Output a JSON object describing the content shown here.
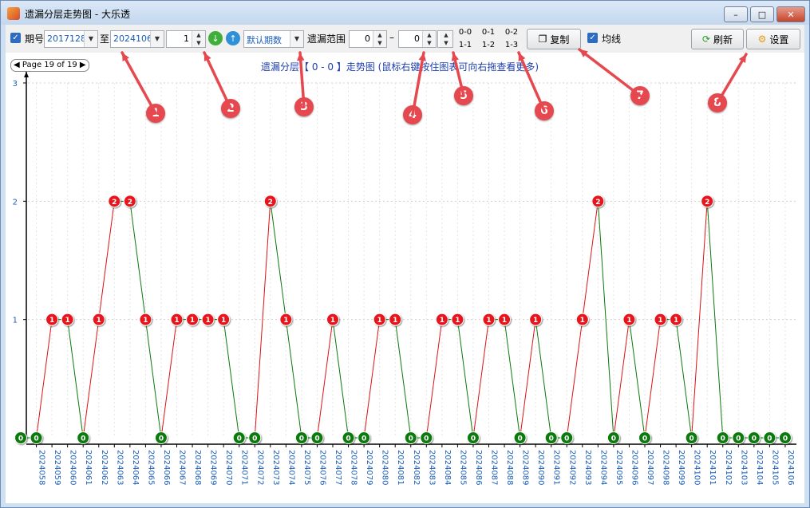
{
  "window": {
    "title": "遗漏分层走势图 - 大乐透"
  },
  "toolbar": {
    "period_label": "期号",
    "from_period": "2017128",
    "to_label": "至",
    "to_period": "2024106",
    "step": "1",
    "default_periods": "默认期数",
    "range_label": "遗漏范围",
    "range_from": "0",
    "range_dash": "–",
    "range_to": "0",
    "copy_label": "复制",
    "avg_label": "均线",
    "refresh_label": "刷新",
    "settings_label": "设置",
    "layer_buttons": [
      "0-0",
      "0-1",
      "0-2",
      "1-1",
      "1-2",
      "1-3"
    ]
  },
  "pager": {
    "text": "Page 19 of 19"
  },
  "chart_data": {
    "type": "line",
    "title": "遗漏分层【 0 - 0 】走势图 (鼠标右键按住图表可向右拖查看更多)",
    "ylim": [
      0,
      3
    ],
    "yticks": [
      1,
      2,
      3
    ],
    "x": [
      "2024058",
      "2024059",
      "2024060",
      "2024061",
      "2024062",
      "2024063",
      "2024064",
      "2024065",
      "2024066",
      "2024067",
      "2024068",
      "2024069",
      "2024070",
      "2024071",
      "2024072",
      "2024073",
      "2024074",
      "2024075",
      "2024076",
      "2024077",
      "2024078",
      "2024079",
      "2024080",
      "2024081",
      "2024082",
      "2024083",
      "2024084",
      "2024085",
      "2024086",
      "2024087",
      "2024088",
      "2024089",
      "2024090",
      "2024091",
      "2024092",
      "2024093",
      "2024094",
      "2024095",
      "2024096",
      "2024097",
      "2024098",
      "2024099",
      "2024100",
      "2024101",
      "2024102",
      "2024103",
      "2024104",
      "2024105",
      "2024106"
    ],
    "series": [
      {
        "values": [
          0,
          0,
          1,
          1,
          0,
          1,
          2,
          2,
          1,
          0,
          1,
          1,
          1,
          1,
          0,
          0,
          2,
          1,
          0,
          0,
          1,
          0,
          0,
          1,
          1,
          0,
          0,
          1,
          1,
          0,
          1,
          1,
          0,
          1,
          0,
          0,
          1,
          2,
          0,
          1,
          0,
          1,
          1,
          0,
          2,
          0,
          0,
          0,
          0,
          0
        ]
      }
    ],
    "colors": {
      "rise": "#dd1111",
      "fall": "#0b7a0b",
      "zero": "#0b7a0b",
      "nonzero": "#e8141b"
    },
    "axis_label_color": "#1b5db8"
  },
  "callouts": [
    "1",
    "2",
    "3",
    "4",
    "5",
    "6",
    "7",
    "8"
  ]
}
